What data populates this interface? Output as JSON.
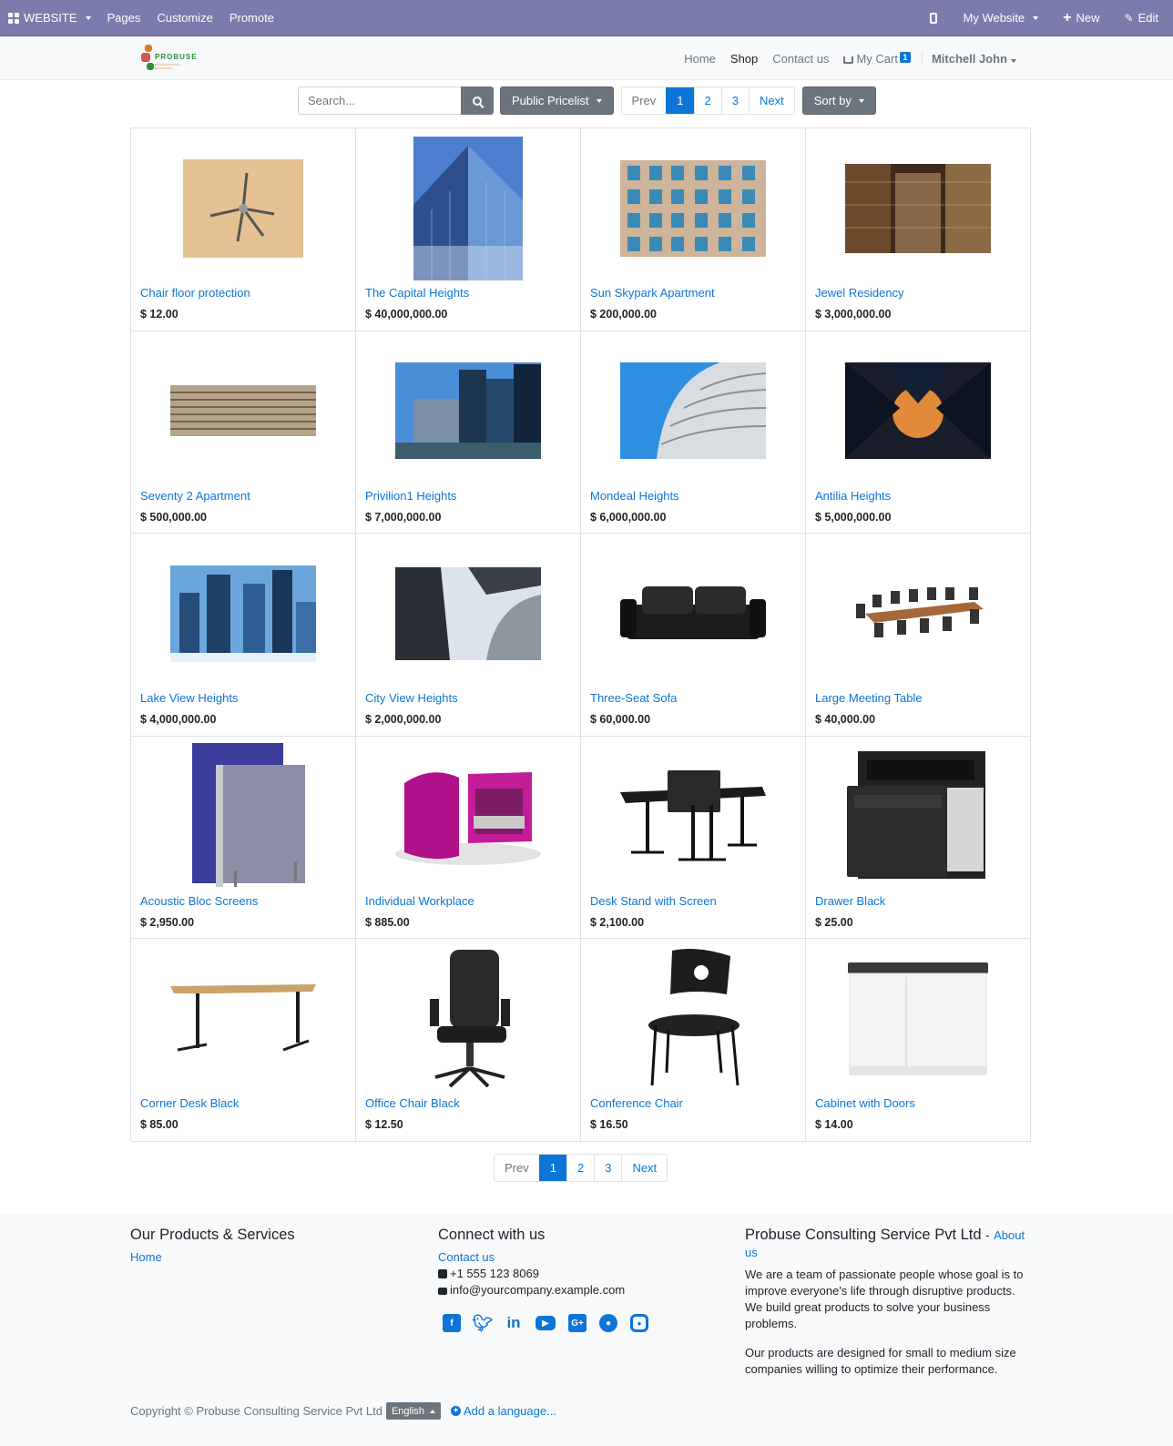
{
  "adminbar": {
    "brand": "WEBSITE",
    "menu": [
      "Pages",
      "Customize",
      "Promote"
    ],
    "site_selector": "My Website",
    "new_label": "New",
    "edit_label": "Edit",
    "color": "#7c7bad"
  },
  "header": {
    "logo_text": "PROBUSE",
    "logo_subtext": "PROFESSIONAL BUSINESS",
    "nav": [
      "Home",
      "Shop",
      "Contact us"
    ],
    "active_nav": "Shop",
    "cart_label": "My Cart",
    "cart_count": "1",
    "user_name": "Mitchell John"
  },
  "toolbar": {
    "search_placeholder": "Search...",
    "pricelist_label": "Public Pricelist",
    "pager": {
      "prev": "Prev",
      "pages": [
        "1",
        "2",
        "3"
      ],
      "next": "Next",
      "active": "1"
    },
    "sort_label": "Sort by"
  },
  "products": [
    {
      "name": "Chair floor protection",
      "price": "$ 12.00"
    },
    {
      "name": "The Capital Heights",
      "price": "$ 40,000,000.00"
    },
    {
      "name": "Sun Skypark Apartment",
      "price": "$ 200,000.00"
    },
    {
      "name": "Jewel Residency",
      "price": "$ 3,000,000.00"
    },
    {
      "name": "Seventy 2 Apartment",
      "price": "$ 500,000.00"
    },
    {
      "name": "Privilion1 Heights",
      "price": "$ 7,000,000.00"
    },
    {
      "name": "Mondeal Heights",
      "price": "$ 6,000,000.00"
    },
    {
      "name": "Antilia Heights",
      "price": "$ 5,000,000.00"
    },
    {
      "name": "Lake View Heights",
      "price": "$ 4,000,000.00"
    },
    {
      "name": "City View Heights",
      "price": "$ 2,000,000.00"
    },
    {
      "name": "Three-Seat Sofa",
      "price": "$ 60,000.00"
    },
    {
      "name": "Large Meeting Table",
      "price": "$ 40,000.00"
    },
    {
      "name": "Acoustic Bloc Screens",
      "price": "$ 2,950.00"
    },
    {
      "name": "Individual Workplace",
      "price": "$ 885.00"
    },
    {
      "name": "Desk Stand with Screen",
      "price": "$ 2,100.00"
    },
    {
      "name": "Drawer Black",
      "price": "$ 25.00"
    },
    {
      "name": "Corner Desk Black",
      "price": "$ 85.00"
    },
    {
      "name": "Office Chair Black",
      "price": "$ 12.50"
    },
    {
      "name": "Conference Chair",
      "price": "$ 16.50"
    },
    {
      "name": "Cabinet with Doors",
      "price": "$ 14.00"
    }
  ],
  "footer": {
    "col1": {
      "title": "Our Products & Services",
      "links": [
        "Home"
      ]
    },
    "col2": {
      "title": "Connect with us",
      "contact_link": "Contact us",
      "phone": "+1 555 123 8069",
      "email": "info@yourcompany.example.com",
      "social_icons": [
        "facebook-icon",
        "twitter-icon",
        "linkedin-icon",
        "youtube-icon",
        "google-plus-icon",
        "github-icon",
        "instagram-icon"
      ]
    },
    "col3": {
      "company": "Probuse Consulting Service Pvt Ltd",
      "separator": "-",
      "about_link": "About us",
      "para1": "We are a team of passionate people whose goal is to improve everyone's life through disruptive products. We build great products to solve your business problems.",
      "para2": "Our products are designed for small to medium size companies willing to optimize their performance."
    },
    "copyright": "Copyright © Probuse Consulting Service Pvt Ltd",
    "language": "English",
    "add_language": "Add a language..."
  },
  "colors": {
    "link": "#0c75d7",
    "active_page": "#0c75d7",
    "button_grey": "#6c757d"
  }
}
